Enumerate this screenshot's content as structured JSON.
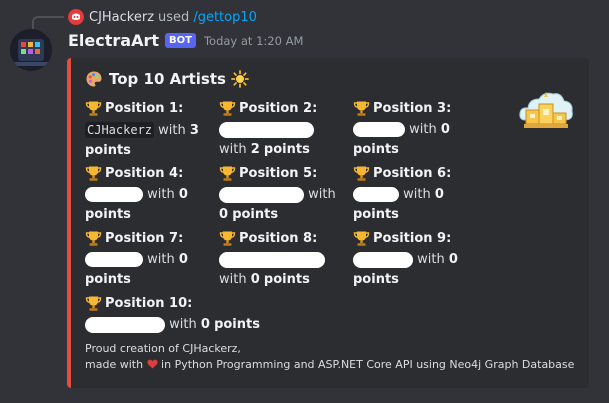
{
  "reply": {
    "user": "CJHackerz",
    "action": "used",
    "command": "/gettop10"
  },
  "message": {
    "author": "ElectraArt",
    "badge": "BOT",
    "timestamp": "Today at 1:20 AM"
  },
  "embed": {
    "accent_color": "#e74c3c",
    "title": "Top 10 Artists",
    "title_icon_left": "palette-emoji",
    "title_icon_right": "sun-emoji",
    "thumbnail": "podium-icon",
    "positions": [
      {
        "label": "Position 1:",
        "name": "CJHackerz",
        "redacted": false,
        "with": "with",
        "points": "3",
        "points_word": "points"
      },
      {
        "label": "Position 2:",
        "name": "",
        "redacted": true,
        "with": "with",
        "points": "2",
        "points_word": "points"
      },
      {
        "label": "Position 3:",
        "name": "",
        "redacted": true,
        "with": "with",
        "points": "0",
        "points_word": "points"
      },
      {
        "label": "Position 4:",
        "name": "",
        "redacted": true,
        "with": "with",
        "points": "0",
        "points_word": "points"
      },
      {
        "label": "Position 5:",
        "name": "",
        "redacted": true,
        "with": "with",
        "points": "0",
        "points_word": "points"
      },
      {
        "label": "Position 6:",
        "name": "",
        "redacted": true,
        "with": "with",
        "points": "0",
        "points_word": "points"
      },
      {
        "label": "Position 7:",
        "name": "",
        "redacted": true,
        "with": "with",
        "points": "0",
        "points_word": "points"
      },
      {
        "label": "Position 8:",
        "name": "",
        "redacted": true,
        "with": "with",
        "points": "0",
        "points_word": "points"
      },
      {
        "label": "Position 9:",
        "name": "",
        "redacted": true,
        "with": "with",
        "points": "0",
        "points_word": "points"
      },
      {
        "label": "Position 10:",
        "name": "",
        "redacted": true,
        "with": "with",
        "points": "0",
        "points_word": "points"
      }
    ],
    "footer_line1": "Proud creation of CJHackerz,",
    "footer_line2_pre": "made with",
    "footer_line2_post": "in Python Programming and ASP.NET Core API using Neo4j Graph Database"
  }
}
